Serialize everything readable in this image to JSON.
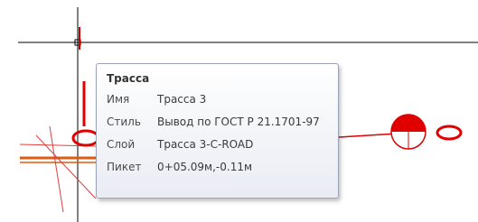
{
  "tooltip": {
    "title": "Трасса",
    "rows": [
      {
        "key": "Имя",
        "value": "Трасса 3"
      },
      {
        "key": "Стиль",
        "value": "Вывод по ГОСТ Р 21.1701-97"
      },
      {
        "key": "Слой",
        "value": "Трасса 3-C-ROAD"
      },
      {
        "key": "Пикет",
        "value": "0+05.09м,-0.11м"
      }
    ]
  },
  "colors": {
    "crosshair": "#000000",
    "alignment": "#e00000",
    "road_edge": "#e06010"
  }
}
